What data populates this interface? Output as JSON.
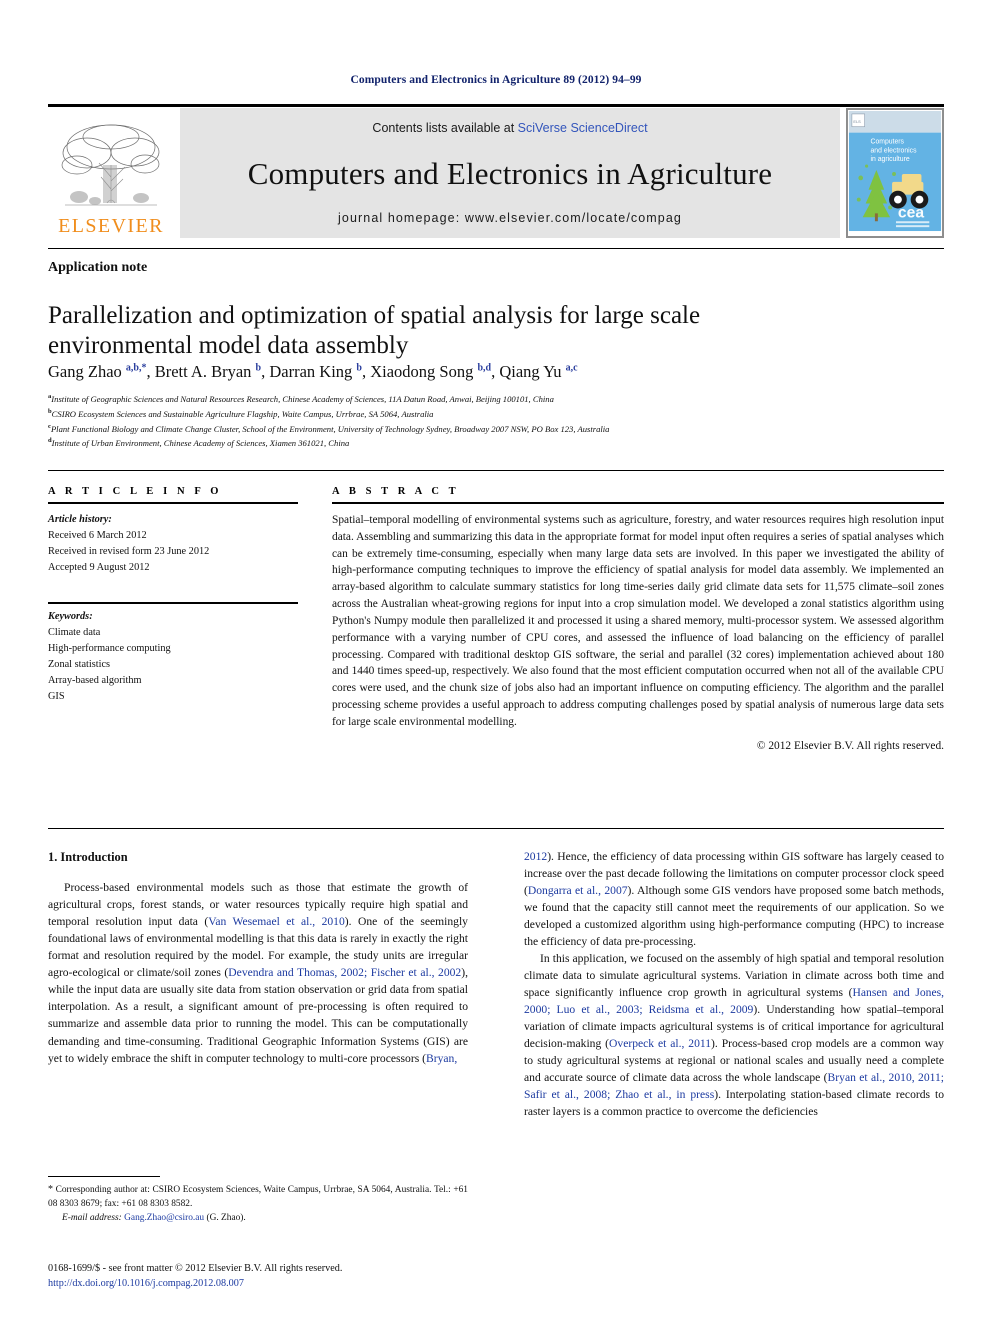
{
  "running_head": "Computers and Electronics in Agriculture 89 (2012) 94–99",
  "masthead": {
    "contents_prefix": "Contents lists available at ",
    "sciencedirect": "SciVerse ScienceDirect",
    "journal_title": "Computers and Electronics in Agriculture",
    "homepage": "journal homepage: www.elsevier.com/locate/compag",
    "publisher_wordmark": "ELSEVIER",
    "cover_title_line1": "Computers",
    "cover_title_line2": "and electronics",
    "cover_title_line3": "in agriculture",
    "cover_logo_text": "cea"
  },
  "article": {
    "type_label": "Application note",
    "title": "Parallelization and optimization of spatial analysis for large scale environmental model data assembly",
    "authors_html": "Gang Zhao <sup>a,b,*</sup>, Brett A. Bryan <sup>b</sup>, Darran King <sup>b</sup>, Xiaodong Song <sup>b,d</sup>, Qiang Yu <sup>a,c</sup>",
    "affiliations": [
      {
        "mark": "a",
        "text": "Institute of Geographic Sciences and Natural Resources Research, Chinese Academy of Sciences, 11A Datun Road, Anwai, Beijing 100101, China"
      },
      {
        "mark": "b",
        "text": "CSIRO Ecosystem Sciences and Sustainable Agriculture Flagship, Waite Campus, Urrbrae, SA 5064, Australia"
      },
      {
        "mark": "c",
        "text": "Plant Functional Biology and Climate Change Cluster, School of the Environment, University of Technology Sydney, Broadway 2007 NSW, PO Box 123, Australia"
      },
      {
        "mark": "d",
        "text": "Institute of Urban Environment, Chinese Academy of Sciences, Xiamen 361021, China"
      }
    ]
  },
  "info": {
    "heading": "A R T I C L E   I N F O",
    "history_label": "Article history:",
    "history": [
      "Received 6 March 2012",
      "Received in revised form 23 June 2012",
      "Accepted 9 August 2012"
    ],
    "keywords_label": "Keywords:",
    "keywords": [
      "Climate data",
      "High-performance computing",
      "Zonal statistics",
      "Array-based algorithm",
      "GIS"
    ]
  },
  "abstract": {
    "heading": "A B S T R A C T",
    "text": "Spatial–temporal modelling of environmental systems such as agriculture, forestry, and water resources requires high resolution input data. Assembling and summarizing this data in the appropriate format for model input often requires a series of spatial analyses which can be extremely time-consuming, especially when many large data sets are involved. In this paper we investigated the ability of high-performance computing techniques to improve the efficiency of spatial analysis for model data assembly. We implemented an array-based algorithm to calculate summary statistics for long time-series daily grid climate data sets for 11,575 climate–soil zones across the Australian wheat-growing regions for input into a crop simulation model. We developed a zonal statistics algorithm using Python's Numpy module then parallelized it and processed it using a shared memory, multi-processor system. We assessed algorithm performance with a varying number of CPU cores, and assessed the influence of load balancing on the efficiency of parallel processing. Compared with traditional desktop GIS software, the serial and parallel (32 cores) implementation achieved about 180 and 1440 times speed-up, respectively. We also found that the most efficient computation occurred when not all of the available CPU cores were used, and the chunk size of jobs also had an important influence on computing efficiency. The algorithm and the parallel processing scheme provides a useful approach to address computing challenges posed by spatial analysis of numerous large data sets for large scale environmental modelling.",
    "copyright": "© 2012 Elsevier B.V. All rights reserved."
  },
  "body": {
    "section_heading": "1. Introduction",
    "left_p1_html": "Process-based environmental models such as those that estimate the growth of agricultural crops, forest stands, or water resources typically require high spatial and temporal resolution input data (<span class=\"ref\">Van Wesemael et al., 2010</span>). One of the seemingly foundational laws of environmental modelling is that this data is rarely in exactly the right format and resolution required by the model. For example, the study units are irregular agro-ecological or climate/soil zones (<span class=\"ref\">Devendra and Thomas, 2002; Fischer et al., 2002</span>), while the input data are usually site data from station observation or grid data from spatial interpolation. As a result, a significant amount of pre-processing is often required to summarize and assemble data prior to running the model. This can be computationally demanding and time-consuming. Traditional Geographic Information Systems (GIS) are yet to widely embrace the shift in computer technology to multi-core processors (<span class=\"ref\">Bryan,</span>",
    "right_p1_html": "<span class=\"ref\">2012</span>). Hence, the efficiency of data processing within GIS software has largely ceased to increase over the past decade following the limitations on computer processor clock speed (<span class=\"ref\">Dongarra et al., 2007</span>). Although some GIS vendors have proposed some batch methods, we found that the capacity still cannot meet the requirements of our application. So we developed a customized algorithm using high-performance computing (HPC) to increase the efficiency of data pre-processing.",
    "right_p2_html": "In this application, we focused on the assembly of high spatial and temporal resolution climate data to simulate agricultural systems. Variation in climate across both time and space significantly influence crop growth in agricultural systems (<span class=\"ref\">Hansen and Jones, 2000; Luo et al., 2003; Reidsma et al., 2009</span>). Understanding how spatial–temporal variation of climate impacts agricultural systems is of critical importance for agricultural decision-making (<span class=\"ref\">Overpeck et al., 2011</span>). Process-based crop models are a common way to study agricultural systems at regional or national scales and usually need a complete and accurate source of climate data across the whole landscape (<span class=\"ref\">Bryan et al., 2010, 2011; Safir et al., 2008; Zhao et al., in press</span>). Interpolating station-based climate records to raster layers is a common practice to overcome the deficiencies"
  },
  "footnotes": {
    "corresponding_html": "<span class=\"star\">*</span> Corresponding author at: CSIRO Ecosystem Sciences, Waite Campus, Urrbrae, SA 5064, Australia. Tel.: +61 08 8303 8679; fax: +61 08 8303 8582.",
    "email_html": "<span class=\"em\">E-mail address:</span> <span class=\"lnk\">Gang.Zhao@csiro.au</span> (G. Zhao).",
    "issn_line": "0168-1699/$ - see front matter © 2012 Elsevier B.V. All rights reserved.",
    "doi": "http://dx.doi.org/10.1016/j.compag.2012.08.007"
  }
}
